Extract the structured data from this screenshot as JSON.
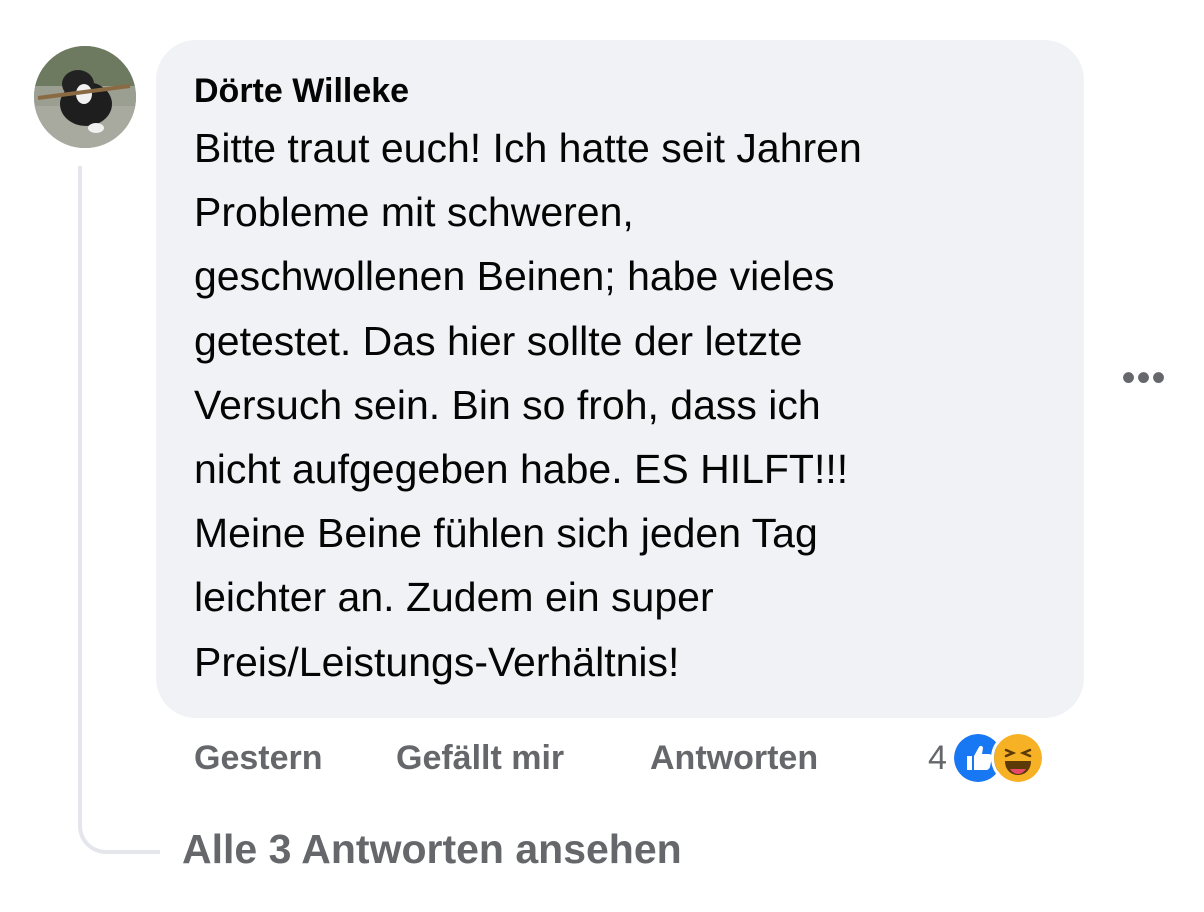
{
  "comment": {
    "author": "Dörte Willeke",
    "text": "Bitte traut euch! Ich hatte seit Jahren\nProbleme mit schweren,\ngeschwollenen Beinen; habe vieles\ngetestet. Das hier sollte der letzte\nVersuch sein. Bin so froh, dass ich\nnicht aufgegeben habe. ES HILFT!!!\nMeine Beine fühlen sich jeden Tag\nleichter an. Zudem ein super\nPreis/Leistungs-Verhältnis!",
    "timestamp": "Gestern",
    "like_label": "Gefällt mir",
    "reply_label": "Antworten",
    "more_label": "•••",
    "reactions": {
      "count": "4",
      "types": [
        "like-icon",
        "haha-icon"
      ],
      "like_color": "#1877f2",
      "haha_color": "#f7b125"
    }
  },
  "replies": {
    "view_label": "Alle 3 Antworten ansehen"
  },
  "colors": {
    "bubble": "#f0f2f5",
    "text_primary": "#050505",
    "text_secondary": "#65676b",
    "thread_line": "#e4e6eb"
  }
}
